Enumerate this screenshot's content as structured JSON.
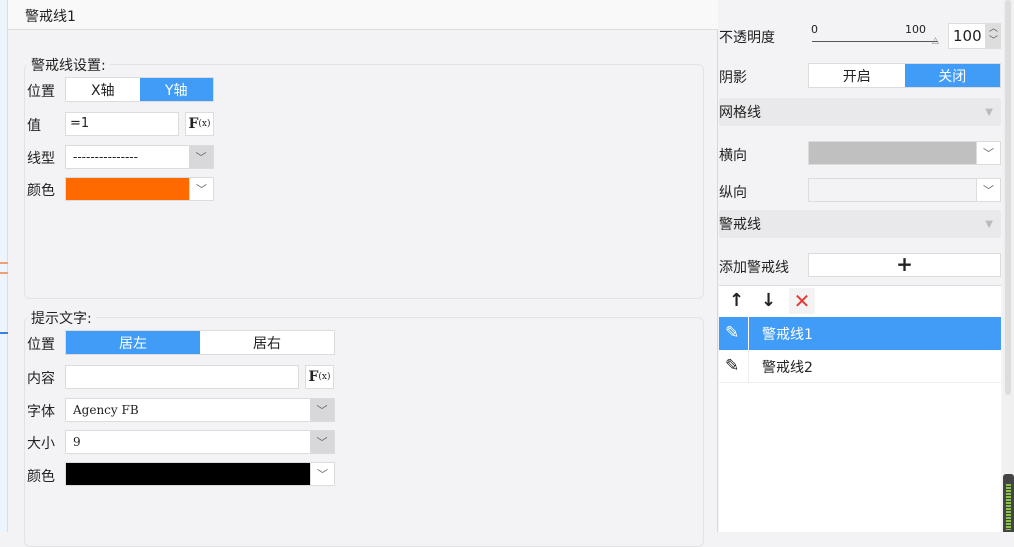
{
  "title": "警戒线1",
  "line_settings": {
    "legend": "警戒线设置:",
    "position_label": "位置",
    "axis_x": "X轴",
    "axis_y": "Y轴",
    "value_label": "值",
    "value": "=1",
    "fx_label": "F",
    "fx_sub": "(x)",
    "linetype_label": "线型",
    "linetype_value": "---------------",
    "color_label": "颜色",
    "color": "#ff6a00"
  },
  "tip_text": {
    "legend": "提示文字:",
    "position_label": "位置",
    "left": "居左",
    "right": "居右",
    "content_label": "内容",
    "content_value": "",
    "font_label": "字体",
    "font_value": "Agency FB",
    "size_label": "大小",
    "size_value": "9",
    "color_label": "颜色",
    "color": "#000000"
  },
  "right": {
    "opacity_label": "不透明度",
    "slider_min": "0",
    "slider_max": "100",
    "opacity_value": "100",
    "opacity": 1.0,
    "shadow_label": "阴影",
    "shadow_on": "开启",
    "shadow_off": "关闭",
    "grid_header": "网格线",
    "horizontal_label": "横向",
    "horizontal_color": "#c0c0c0",
    "vertical_label": "纵向",
    "alert_header": "警戒线",
    "add_label": "添加警戒线",
    "add_icon": "+",
    "list": [
      {
        "name": "警戒线1",
        "selected": true
      },
      {
        "name": "警戒线2",
        "selected": false
      }
    ]
  }
}
